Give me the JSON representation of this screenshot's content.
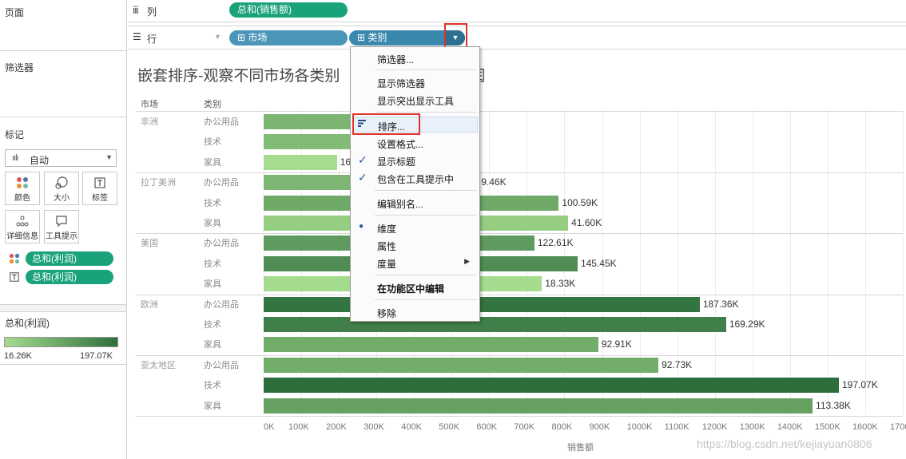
{
  "left_panel": {
    "pages_title": "页面",
    "filters_title": "筛选器",
    "marks_title": "标记",
    "mark_type": "自动",
    "mark_buttons": [
      {
        "label": "颜色",
        "icon": "color-icon"
      },
      {
        "label": "大小",
        "icon": "size-icon"
      },
      {
        "label": "标签",
        "icon": "label-icon"
      },
      {
        "label": "详细信息",
        "icon": "detail-icon"
      },
      {
        "label": "工具提示",
        "icon": "tooltip-icon"
      }
    ],
    "mark_pills": [
      "总和(利润)",
      "总和(利润)"
    ],
    "legend_title": "总和(利润)",
    "legend_min": "16.26K",
    "legend_max": "197.07K",
    "legend_colors": [
      "#a6dc8f",
      "#2e6e3c"
    ]
  },
  "shelves": {
    "columns_label": "列",
    "columns_pill": "总和(销售额)",
    "rows_label": "行",
    "rows_pills": [
      "市场",
      "类别"
    ]
  },
  "chart": {
    "title_left": "嵌套排序-观察不同市场各类别",
    "title_right": "润",
    "header_market": "市场",
    "header_category": "类别",
    "x_axis_label": "销售额",
    "chart_data": {
      "type": "bar",
      "orientation": "horizontal",
      "xlabel": "销售额",
      "xlim": [
        0,
        1700000
      ],
      "x_ticks": [
        "0K",
        "100K",
        "200K",
        "300K",
        "400K",
        "500K",
        "600K",
        "700K",
        "800K",
        "900K",
        "1000K",
        "1100K",
        "1200K",
        "1300K",
        "1400K",
        "1500K",
        "1600K",
        "1700K"
      ],
      "color_measure": "总和(利润)",
      "color_range": [
        16.26,
        197.07
      ],
      "groups": [
        {
          "market": "非洲",
          "rows": [
            {
              "category": "办公用品",
              "sales": 260000,
              "profit": 80,
              "label": ""
            },
            {
              "category": "技术",
              "sales": 290000,
              "profit": 70,
              "label": ""
            },
            {
              "category": "家具",
              "sales": 195000,
              "profit": 16.26,
              "label": "16"
            }
          ]
        },
        {
          "market": "拉丁美洲",
          "rows": [
            {
              "category": "办公用品",
              "sales": 570000,
              "profit": 79.46,
              "label": "9.46K"
            },
            {
              "category": "技术",
              "sales": 785000,
              "profit": 100.59,
              "label": "100.59K"
            },
            {
              "category": "家具",
              "sales": 810000,
              "profit": 41.6,
              "label": "41.60K"
            }
          ]
        },
        {
          "market": "美国",
          "rows": [
            {
              "category": "办公用品",
              "sales": 720000,
              "profit": 122.61,
              "label": "122.61K"
            },
            {
              "category": "技术",
              "sales": 835000,
              "profit": 145.45,
              "label": "145.45K"
            },
            {
              "category": "家具",
              "sales": 740000,
              "profit": 18.33,
              "label": "18.33K"
            }
          ]
        },
        {
          "market": "欧洲",
          "rows": [
            {
              "category": "办公用品",
              "sales": 1160000,
              "profit": 187.36,
              "label": "187.36K"
            },
            {
              "category": "技术",
              "sales": 1230000,
              "profit": 169.29,
              "label": "169.29K"
            },
            {
              "category": "家具",
              "sales": 890000,
              "profit": 92.91,
              "label": "92.91K"
            }
          ]
        },
        {
          "market": "亚太地区",
          "rows": [
            {
              "category": "办公用品",
              "sales": 1050000,
              "profit": 92.73,
              "label": "92.73K"
            },
            {
              "category": "技术",
              "sales": 1530000,
              "profit": 197.07,
              "label": "197.07K"
            },
            {
              "category": "家具",
              "sales": 1460000,
              "profit": 113.38,
              "label": "113.38K"
            }
          ]
        }
      ]
    }
  },
  "context_menu": {
    "items": [
      {
        "label": "筛选器...",
        "check": ""
      },
      {
        "label": "显示筛选器",
        "check": ""
      },
      {
        "label": "显示突出显示工具",
        "check": ""
      },
      {
        "label": "排序...",
        "check": ""
      },
      {
        "label": "设置格式...",
        "check": ""
      },
      {
        "label": "显示标题",
        "check": "✓"
      },
      {
        "label": "包含在工具提示中",
        "check": "✓"
      },
      {
        "label": "编辑别名...",
        "check": ""
      },
      {
        "label": "维度",
        "check": "●"
      },
      {
        "label": "属性",
        "check": ""
      },
      {
        "label": "度量",
        "check": ""
      },
      {
        "label": "在功能区中编辑",
        "check": ""
      },
      {
        "label": "移除",
        "check": ""
      }
    ]
  },
  "watermark": "https://blog.csdn.net/kejiayuan0806"
}
